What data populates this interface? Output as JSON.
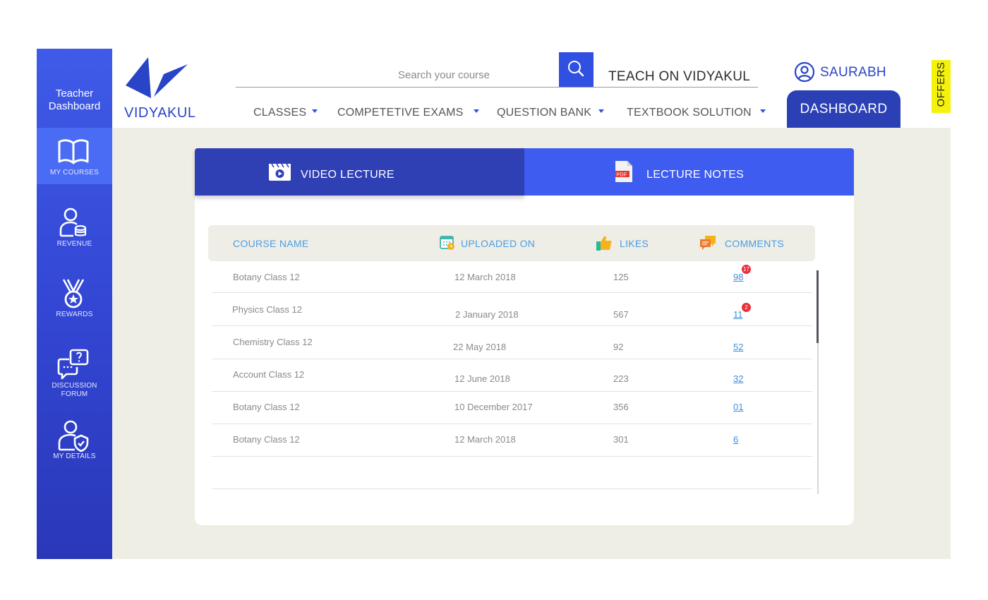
{
  "sidebar": {
    "title_line1": "Teacher",
    "title_line2": "Dashboard",
    "items": [
      {
        "label": "MY COURSES",
        "icon": "book-icon"
      },
      {
        "label": "REVENUE",
        "icon": "user-coins-icon"
      },
      {
        "label": "REWARDS",
        "icon": "medal-icon"
      },
      {
        "label_line1": "DISCUSSION",
        "label_line2": "FORUM",
        "icon": "chat-question-icon"
      },
      {
        "label": "MY DETAILS",
        "icon": "user-shield-icon"
      }
    ]
  },
  "header": {
    "logo_text": "VIDYAKUL",
    "search_placeholder": "Search your course",
    "teach_link": "TEACH ON VIDYAKUL",
    "user_name": "SAURABH",
    "offers": "OFFERS",
    "nav": [
      "CLASSES",
      "COMPETETIVE EXAMS",
      "QUESTION BANK",
      "TEXTBOOK SOLUTION"
    ],
    "dashboard_button": "DASHBOARD"
  },
  "tabs": {
    "video": "VIDEO LECTURE",
    "notes": "LECTURE NOTES",
    "notes_icon_text": "PDF"
  },
  "table": {
    "headers": {
      "course": "COURSE NAME",
      "uploaded": "UPLOADED ON",
      "likes": "LIKES",
      "comments": "COMMENTS"
    },
    "rows": [
      {
        "course": "Botany Class 12",
        "uploaded": "12 March 2018",
        "likes": "125",
        "comments": "98",
        "badge": "17"
      },
      {
        "course": "Physics Class 12",
        "uploaded": "2 January 2018",
        "likes": "567",
        "comments": "11",
        "badge": "2"
      },
      {
        "course": "Chemistry Class 12",
        "uploaded": "22 May 2018",
        "likes": "92",
        "comments": "52"
      },
      {
        "course": "Account Class 12",
        "uploaded": "12 June 2018",
        "likes": "223",
        "comments": "32"
      },
      {
        "course": "Botany Class 12",
        "uploaded": "10 December 2017",
        "likes": "356",
        "comments": "01"
      },
      {
        "course": "Botany Class 12",
        "uploaded": "12 March 2018",
        "likes": "301",
        "comments": "6"
      }
    ]
  },
  "colors": {
    "brand_blue": "#2f50e0",
    "sidebar_blue": "#3347d4",
    "dashboard_blue": "#2b40b5",
    "header_text_blue": "#4a9ee8",
    "offers_yellow": "#f4f20a",
    "badge_red": "#e8303a"
  }
}
